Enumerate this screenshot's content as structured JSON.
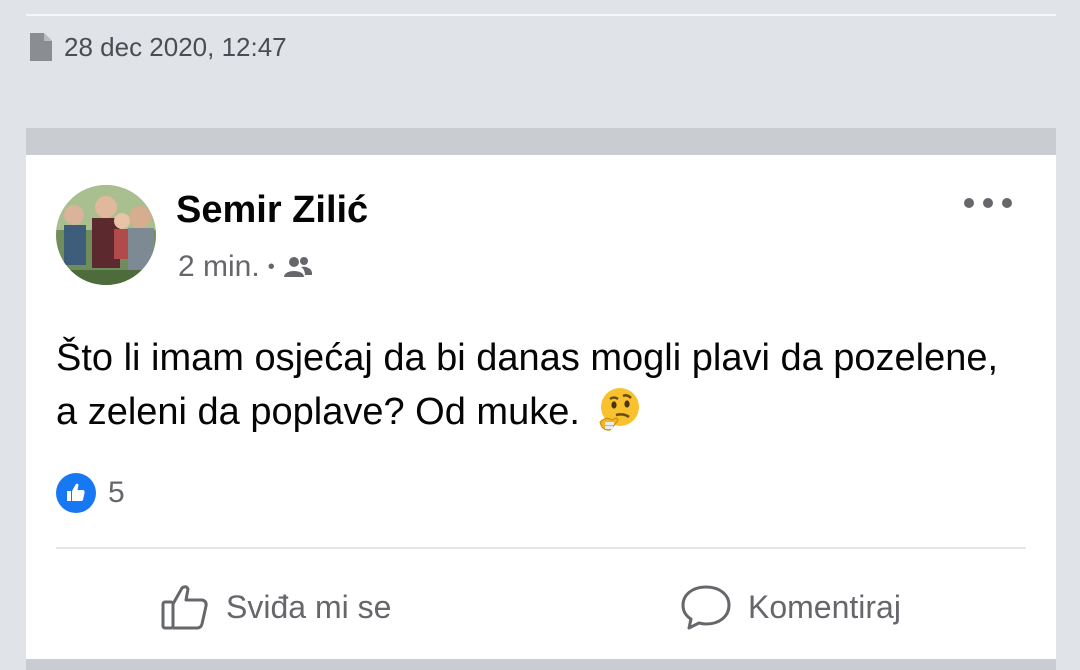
{
  "header": {
    "date_icon": "document-icon",
    "date": "28 dec 2020, 12:47"
  },
  "post": {
    "author": "Semir Zilić",
    "time": "2 min.",
    "separator": "•",
    "audience_icon": "friends-icon",
    "text": "Što li imam osjećaj da bi danas mogli plavi da pozelene, a zeleni da poplave? Od muke.",
    "emoji": "thinking-face",
    "reaction_icon": "like-icon",
    "reaction_count": "5"
  },
  "actions": {
    "like_label": "Sviđa mi se",
    "comment_label": "Komentiraj"
  },
  "colors": {
    "background": "#e0e3e8",
    "like_blue": "#1877f2",
    "muted_text": "#65676b"
  }
}
